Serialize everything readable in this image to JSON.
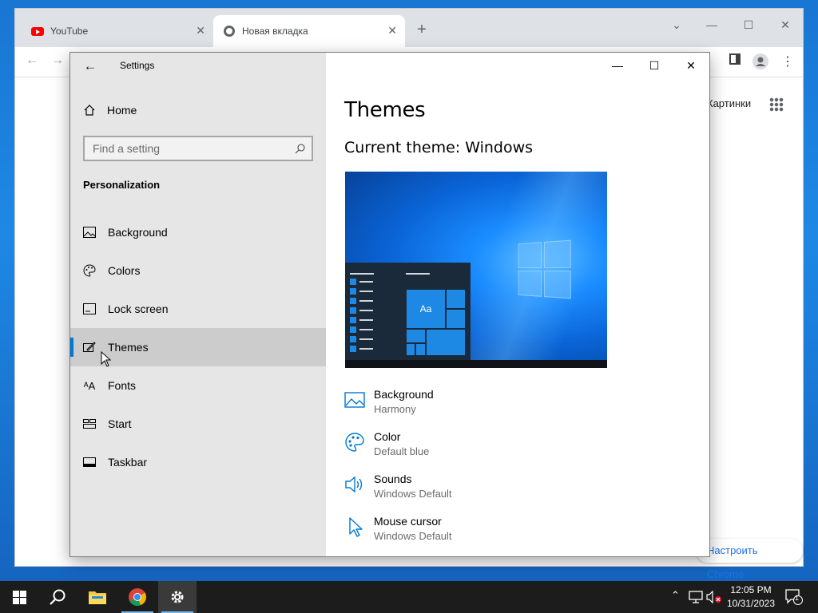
{
  "chrome": {
    "tabs": [
      {
        "label": "YouTube",
        "icon": "youtube-icon"
      },
      {
        "label": "Новая вкладка",
        "icon": "chrome-icon"
      }
    ],
    "ntp": {
      "images_link": "Картинки",
      "customize_button": "Настроить Chrome"
    }
  },
  "settings": {
    "window_title": "Settings",
    "home_label": "Home",
    "search_placeholder": "Find a setting",
    "section_title": "Personalization",
    "nav_items": [
      {
        "label": "Background",
        "icon": "picture-icon"
      },
      {
        "label": "Colors",
        "icon": "palette-icon"
      },
      {
        "label": "Lock screen",
        "icon": "lock-screen-icon"
      },
      {
        "label": "Themes",
        "icon": "themes-brush-icon",
        "selected": true
      },
      {
        "label": "Fonts",
        "icon": "fonts-icon"
      },
      {
        "label": "Start",
        "icon": "start-icon"
      },
      {
        "label": "Taskbar",
        "icon": "taskbar-icon"
      }
    ],
    "page_title": "Themes",
    "current_theme": "Current theme: Windows",
    "preview_tile_text": "Aa",
    "properties": [
      {
        "name": "Background",
        "value": "Harmony",
        "icon": "picture-icon"
      },
      {
        "name": "Color",
        "value": "Default blue",
        "icon": "palette-icon"
      },
      {
        "name": "Sounds",
        "value": "Windows Default",
        "icon": "speaker-icon"
      },
      {
        "name": "Mouse cursor",
        "value": "Windows Default",
        "icon": "cursor-icon"
      }
    ]
  },
  "taskbar": {
    "time": "12:05 PM",
    "date": "10/31/2023",
    "notification_count": "1",
    "pinned": [
      "start-icon",
      "search-icon",
      "file-explorer-icon",
      "chrome-icon",
      "settings-gear-icon"
    ]
  },
  "colors": {
    "accent": "#0078d4",
    "taskbar": "#1c1c1c",
    "nav_background": "#e6e6e6"
  }
}
